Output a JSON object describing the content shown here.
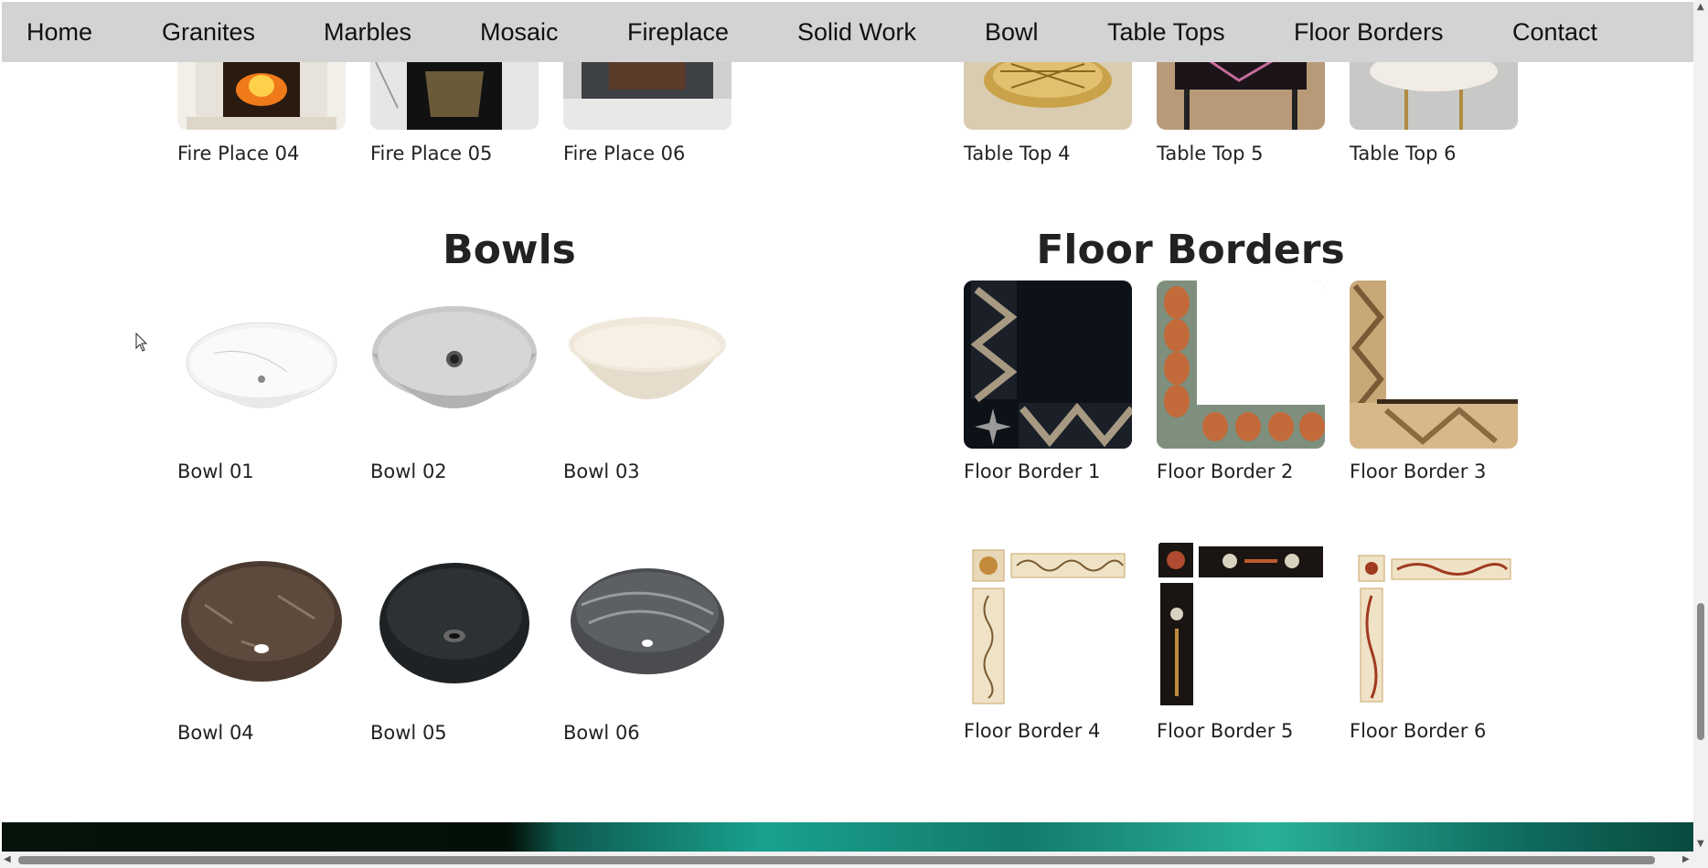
{
  "nav": {
    "items": [
      "Home",
      "Granites",
      "Marbles",
      "Mosaic",
      "Fireplace",
      "Solid Work",
      "Bowl",
      "Table Tops",
      "Floor Borders",
      "Contact"
    ]
  },
  "fireplace": {
    "captions": [
      "Fire Place 04",
      "Fire Place 05",
      "Fire Place 06"
    ]
  },
  "table_tops": {
    "captions": [
      "Table Top 4",
      "Table Top 5",
      "Table Top 6"
    ]
  },
  "bowls": {
    "title": "Bowls",
    "captions": [
      "Bowl 01",
      "Bowl 02",
      "Bowl 03",
      "Bowl 04",
      "Bowl 05",
      "Bowl 06"
    ]
  },
  "floor_borders": {
    "title": "Floor Borders",
    "captions": [
      "Floor Border 1",
      "Floor Border 2",
      "Floor Border 3",
      "Floor Border 4",
      "Floor Border 5",
      "Floor Border 6"
    ]
  },
  "colors": {
    "nav_bg": "#d3d3d3",
    "footer_accent": "#1aa18e"
  }
}
